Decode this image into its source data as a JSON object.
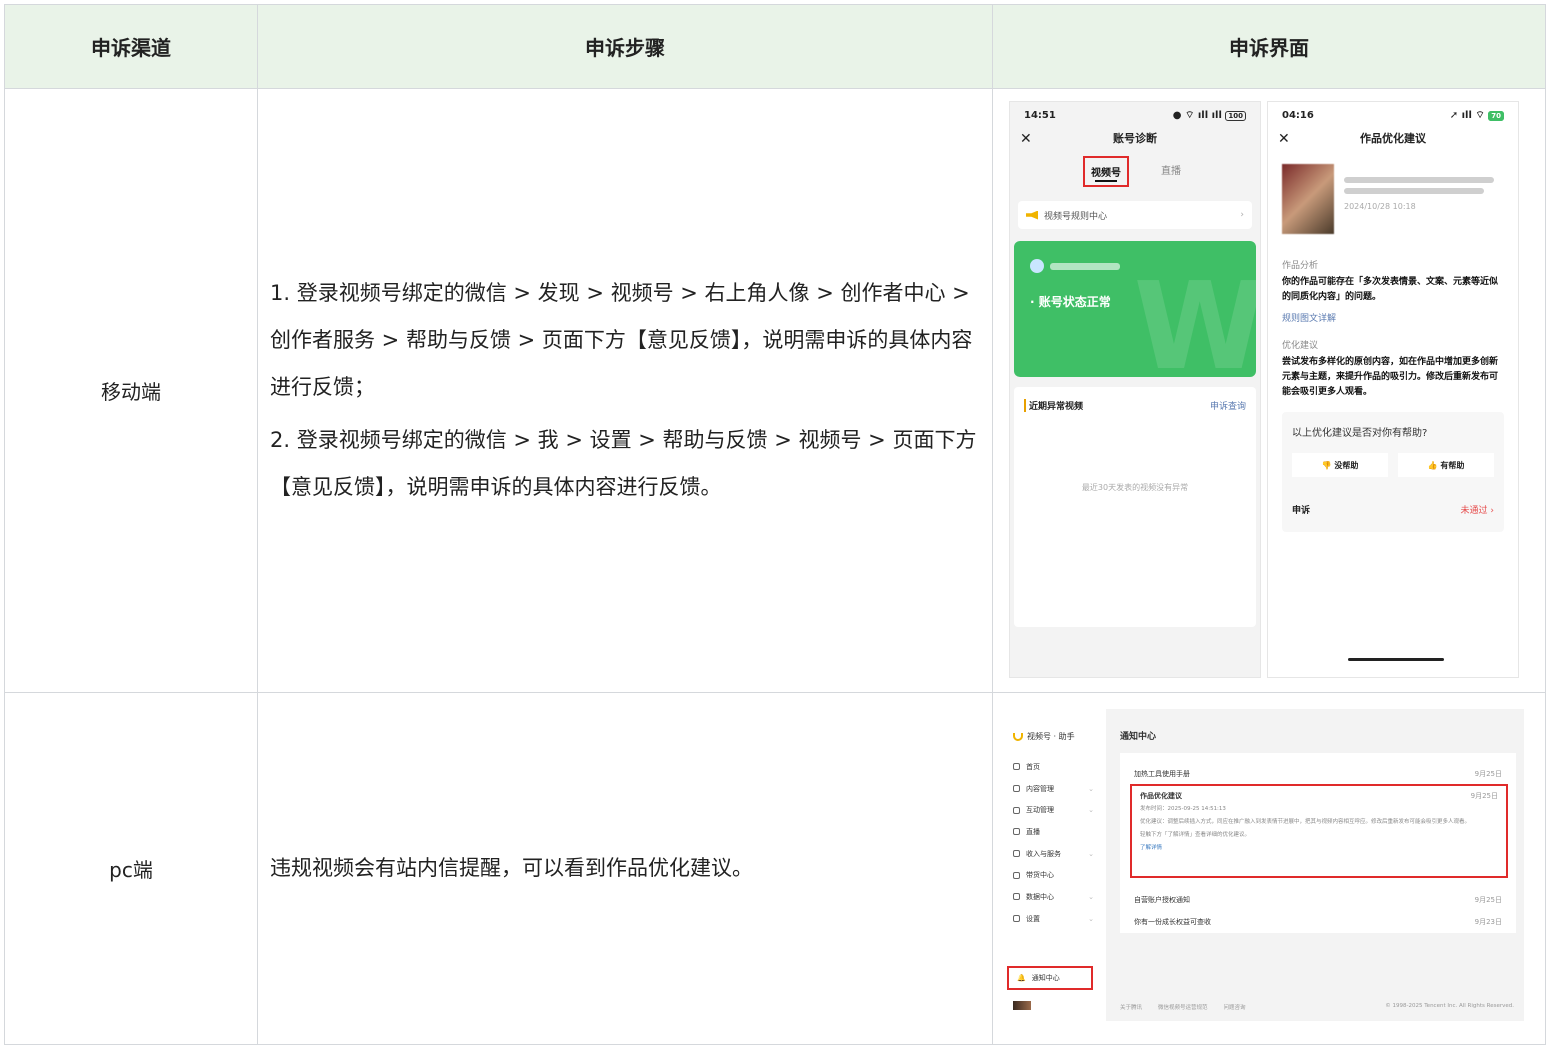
{
  "header": {
    "col1": "申诉渠道",
    "col2": "申诉步骤",
    "col3": "申诉界面"
  },
  "rows": [
    {
      "channel": "移动端",
      "steps": [
        "1. 登录视频号绑定的微信 > 发现 > 视频号 > 右上角人像 > 创作者中心 > 创作者服务 > 帮助与反馈 > 页面下方【意见反馈】，说明需申诉的具体内容进行反馈；",
        "2. 登录视频号绑定的微信 > 我 > 设置 > 帮助与反馈 > 视频号 > 页面下方【意见反馈】，说明需申诉的具体内容进行反馈。"
      ]
    },
    {
      "channel": "pc端",
      "steps": [
        "违规视频会有站内信提醒，可以看到作品优化建议。"
      ]
    }
  ],
  "phone1": {
    "time": "14:51",
    "battery": "100",
    "title": "账号诊断",
    "tab_active": "视频号",
    "tab_other": "直播",
    "rule_center": "视频号规则中心",
    "status": "· 账号状态正常",
    "recent_title": "近期异常视频",
    "recent_link": "申诉查询",
    "recent_empty": "最近30天发表的视频没有异常"
  },
  "phone2": {
    "time": "04:16",
    "battery": "70",
    "title": "作品优化建议",
    "work_date": "2024/10/28 10:18",
    "analysis_label": "作品分析",
    "analysis_body": "你的作品可能存在「多次发表情景、文案、元素等近似的同质化内容」的问题。",
    "analysis_link": "规则图文详解",
    "suggest_label": "优化建议",
    "suggest_body": "尝试发布多样化的原创内容，如在作品中增加更多创新元素与主题，来提升作品的吸引力。修改后重新发布可能会吸引更多人观看。",
    "help_question": "以上优化建议是否对你有帮助?",
    "btn_no": "没帮助",
    "btn_yes": "有帮助",
    "appeal_label": "申诉",
    "appeal_status": "未通过"
  },
  "pc": {
    "brand": "视频号 · 助手",
    "menu": [
      "首页",
      "内容管理",
      "互动管理",
      "直播",
      "收入与服务",
      "带货中心",
      "数据中心",
      "设置"
    ],
    "notice_menu": "通知中心",
    "page_title": "通知中心",
    "items": [
      {
        "title": "加热工具使用手册",
        "date": "9月25日"
      },
      {
        "title": "作品优化建议",
        "date": "9月25日"
      },
      {
        "title": "自营账户授权通知",
        "date": "9月25日"
      },
      {
        "title": "你有一份成长权益可查收",
        "date": "9月23日"
      }
    ],
    "hl_time": "发布时间：2025-09-25 14:51:13",
    "hl_line": "优化建议：调整后续插入方式，同应在推广融入到发表情节进展中，把其与视频内容相互呼应。修改后重新发布可能会吸引更多人观看。",
    "hl_tip": "轻触下方「了解详情」查看详细的优化建议。",
    "hl_link": "了解详情",
    "footer": [
      "关于腾讯",
      "微信视频号运营规范",
      "问题咨询"
    ],
    "copyright": "© 1998-2025 Tencent Inc. All Rights Reserved."
  }
}
